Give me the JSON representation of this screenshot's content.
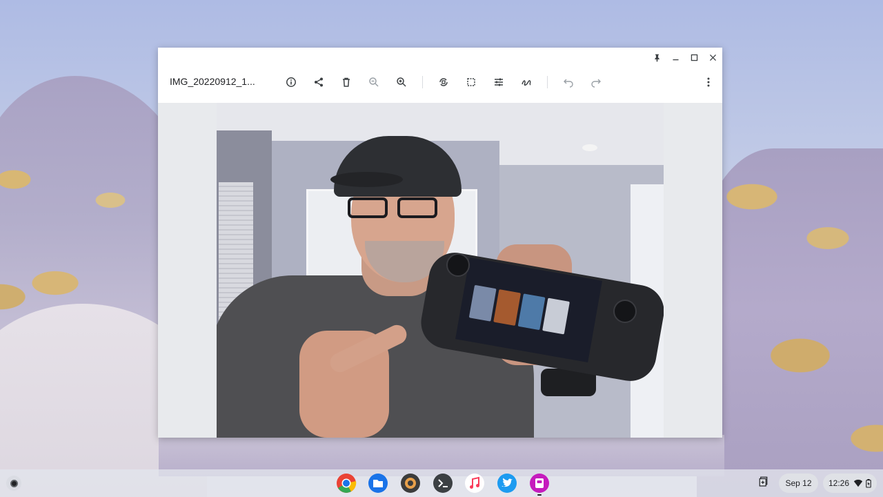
{
  "window": {
    "file_name": "IMG_20220912_1...",
    "caption_icons": [
      "pin-icon",
      "minimize-icon",
      "maximize-icon",
      "close-icon"
    ],
    "toolbar_icons": [
      "info-icon",
      "share-icon",
      "delete-icon",
      "zoom-out-icon",
      "zoom-in-icon",
      "rotate-icon",
      "crop-icon",
      "adjust-icon",
      "annotate-icon",
      "undo-icon",
      "redo-icon",
      "more-icon"
    ]
  },
  "shelf": {
    "apps": [
      "chrome-icon",
      "files-icon",
      "app-icon",
      "terminal-icon",
      "music-icon",
      "twitter-icon",
      "gallery-icon"
    ],
    "date": "Sep 12",
    "time": "12:26",
    "colors": {
      "chrome_red": "#ea4335",
      "files_blue": "#1a73e8",
      "twitter_blue": "#1d9bf0",
      "gallery_pink": "#c51bbd"
    }
  }
}
